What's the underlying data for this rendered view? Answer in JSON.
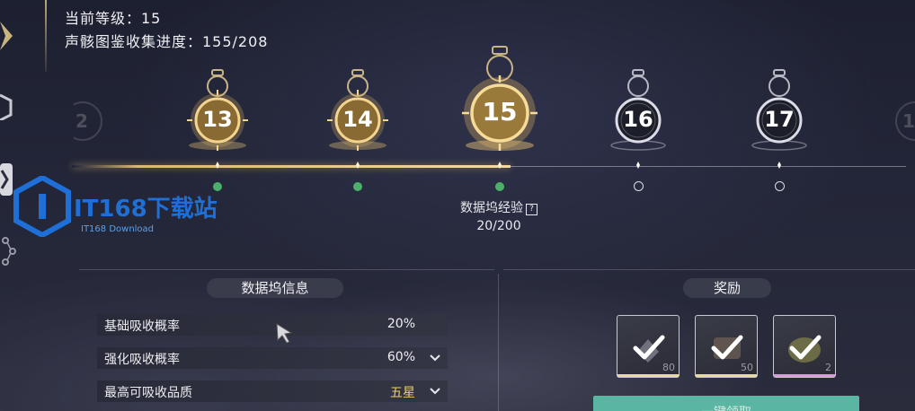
{
  "header": {
    "level_label": "当前等级：15",
    "collection_label": "声骸图鉴收集进度：155/208"
  },
  "track": {
    "nodes": [
      {
        "label": "13",
        "state": "reached",
        "claimed": true
      },
      {
        "label": "14",
        "state": "reached",
        "claimed": true
      },
      {
        "label": "15",
        "state": "current",
        "claimed": true
      },
      {
        "label": "16",
        "state": "locked",
        "claimed": false
      },
      {
        "label": "17",
        "state": "locked",
        "claimed": false
      }
    ],
    "edge_left": "2",
    "edge_right": "1",
    "exp_label": "数据坞经验",
    "exp_help": "?",
    "exp_value": "20/200"
  },
  "info": {
    "title": "数据坞信息",
    "rows": [
      {
        "label": "基础吸收概率",
        "value": "20%",
        "has_dropdown": false
      },
      {
        "label": "强化吸收概率",
        "value": "60%",
        "has_dropdown": true
      },
      {
        "label": "最高可吸收品质",
        "value": "五星",
        "has_dropdown": true
      }
    ]
  },
  "rewards": {
    "title": "奖励",
    "items": [
      {
        "count": "80",
        "rarity_color": "#e8d9a0"
      },
      {
        "count": "50",
        "rarity_color": "#e8d9a0"
      },
      {
        "count": "2",
        "rarity_color": "#d79be6"
      }
    ],
    "claim_label": "一键领取"
  },
  "watermark": {
    "text": "IT168下载站",
    "sub": "IT168 Download"
  },
  "colors": {
    "gold": "#f0c878",
    "check_green": "#4caf6a",
    "claim_button": "#5ab5a2"
  }
}
